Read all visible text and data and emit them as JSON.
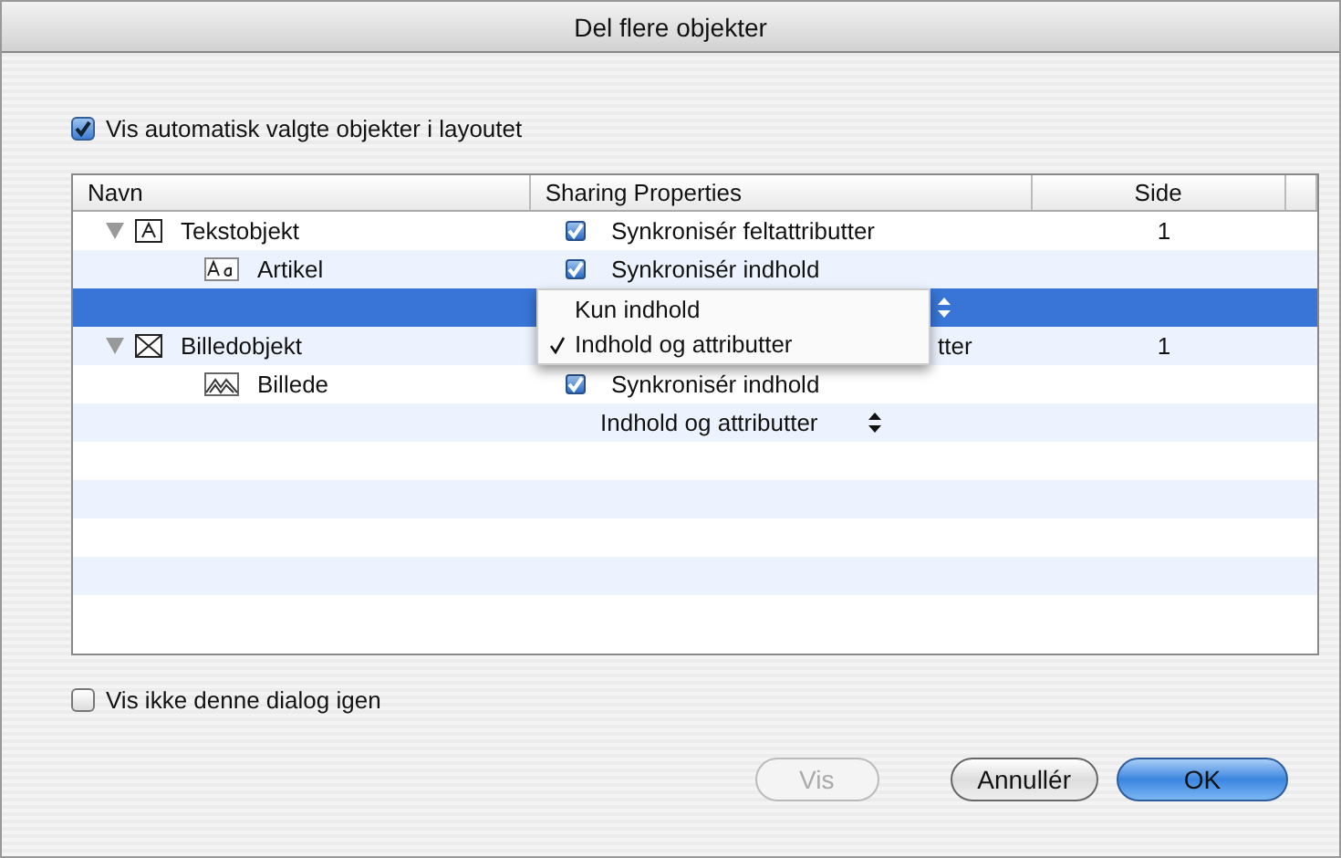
{
  "window": {
    "title": "Del flere objekter"
  },
  "auto_select": {
    "label": "Vis automatisk valgte objekter i layoutet",
    "checked": true
  },
  "table": {
    "columns": [
      "Navn",
      "Sharing Properties",
      "Side"
    ],
    "items": [
      {
        "name": "Tekstobjekt",
        "kind": "text-frame",
        "expanded": true,
        "side": "1",
        "properties": [
          {
            "kind": "checkbox",
            "label": "Synkronisér feltattributter",
            "checked": true,
            "selected": false
          }
        ],
        "children": [
          {
            "name": "Artikel",
            "kind": "article",
            "properties": [
              {
                "kind": "checkbox",
                "label": "Synkronisér indhold",
                "checked": true,
                "selected": false
              },
              {
                "kind": "popup",
                "selected": true
              }
            ]
          }
        ]
      },
      {
        "name": "Billedobjekt",
        "kind": "picture-frame",
        "expanded": true,
        "side": "1",
        "properties": [
          {
            "kind": "fragment",
            "label": "tter",
            "selected": false
          }
        ],
        "children": [
          {
            "name": "Billede",
            "kind": "picture",
            "properties": [
              {
                "kind": "checkbox",
                "label": "Synkronisér indhold",
                "checked": true,
                "selected": false
              },
              {
                "kind": "popup",
                "label": "Indhold og attributter",
                "selected": false
              }
            ]
          }
        ]
      }
    ]
  },
  "popup_menu": {
    "items": [
      {
        "label": "Kun indhold",
        "selected": false
      },
      {
        "label": "Indhold og attributter",
        "selected": true
      }
    ]
  },
  "dont_show": {
    "label": "Vis ikke denne dialog igen",
    "checked": false
  },
  "buttons": [
    {
      "label": "Vis",
      "kind": "disabled"
    },
    {
      "label": "Annullér",
      "kind": "normal"
    },
    {
      "label": "OK",
      "kind": "default"
    }
  ]
}
